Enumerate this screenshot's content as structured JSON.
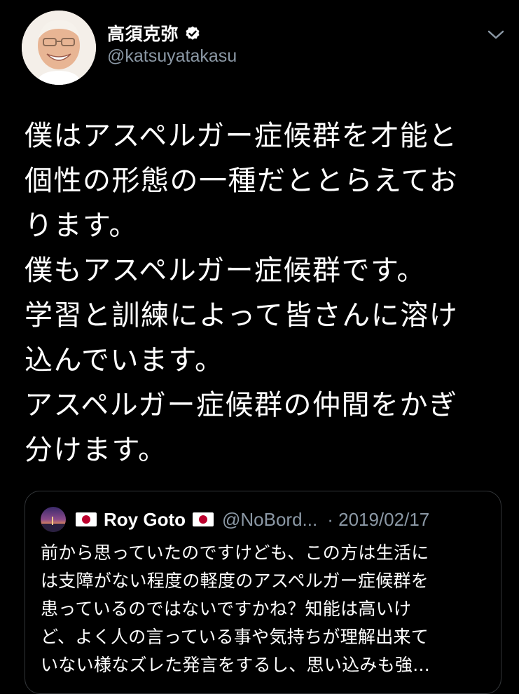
{
  "tweet": {
    "author": {
      "display_name": "高須克弥",
      "handle": "@katsuyatakasu",
      "verified": true,
      "avatar_icon": "avatar-photo"
    },
    "menu_icon": "chevron-down-icon",
    "body_lines": [
      "僕はアスペルガー症候群を才能と",
      "個性の形態の一種だととらえてお",
      "ります。",
      "僕もアスペルガー症候群です。",
      "学習と訓練によって皆さんに溶け",
      "込んでいます。",
      "アスペルガー症候群の仲間をかぎ",
      "分けます。"
    ]
  },
  "quoted_tweet": {
    "display_name": "Roy Goto",
    "flag_icon": "japan-flag-icon",
    "handle": "@NoBord...",
    "date": "· 2019/02/17",
    "text_lines": [
      "前から思っていたのですけども、この方は生活に",
      "は支障がない程度の軽度のアスペルガー症候群を",
      "患っているのではないですかね？知能は高いけ",
      "ど、よく人の言っている事や気持ちが理解出来て",
      "いない様なズレた発言をするし、思い込みも強..."
    ]
  },
  "colors": {
    "background": "#000000",
    "text_primary": "#ffffff",
    "text_secondary": "#8b98a5",
    "border": "#333639",
    "flag_red": "#bc002d"
  }
}
